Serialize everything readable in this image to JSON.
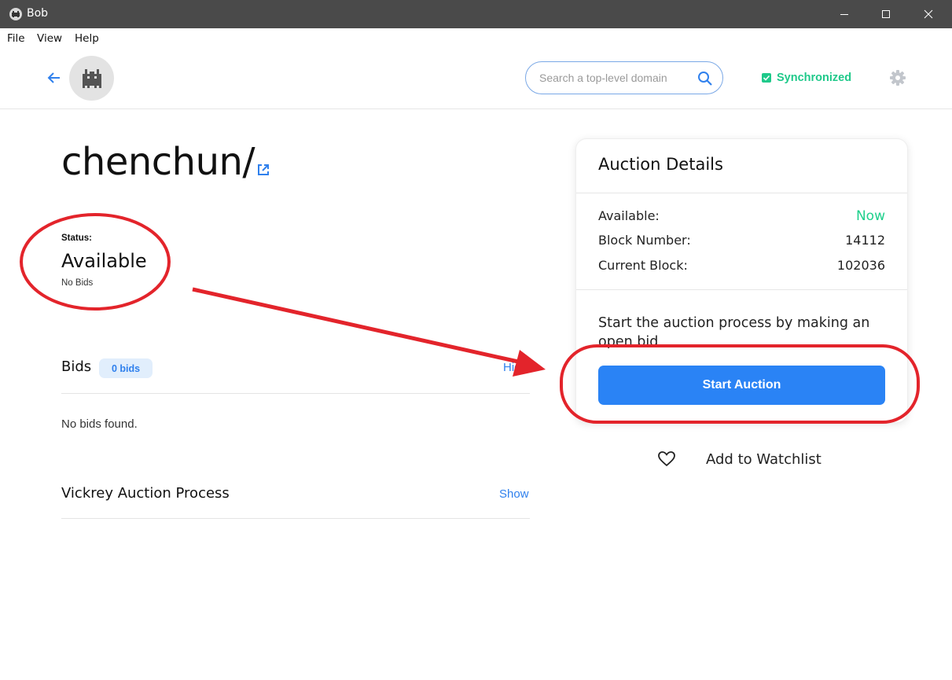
{
  "window": {
    "title": "Bob"
  },
  "menu": {
    "items": [
      "File",
      "View",
      "Help"
    ]
  },
  "header": {
    "search_placeholder": "Search a top-level domain",
    "sync_label": "Synchronized"
  },
  "domain": {
    "name": "chenchun/",
    "status_label": "Status:",
    "status_value": "Available",
    "status_sub": "No Bids"
  },
  "bids": {
    "title": "Bids",
    "badge": "0 bids",
    "toggle": "Hid",
    "empty": "No bids found."
  },
  "vickrey": {
    "title": "Vickrey Auction Process",
    "toggle": "Show"
  },
  "auction_card": {
    "title": "Auction Details",
    "rows": [
      {
        "key": "Available:",
        "value": "Now"
      },
      {
        "key": "Block Number:",
        "value": "14112"
      },
      {
        "key": "Current Block:",
        "value": "102036"
      }
    ],
    "description": "Start the auction process by making an open bid",
    "button": "Start Auction"
  },
  "watchlist": {
    "label": "Add to Watchlist"
  },
  "colors": {
    "accent": "#2a83f5",
    "success": "#1fd08c",
    "annotation": "#e3242b",
    "titlebar": "#4a4a4a"
  },
  "icons": [
    "app-icon",
    "minimize-icon",
    "maximize-icon",
    "close-icon",
    "back-arrow-icon",
    "avatar-icon",
    "search-icon",
    "check-icon",
    "gear-icon",
    "external-link-icon",
    "heart-icon"
  ]
}
